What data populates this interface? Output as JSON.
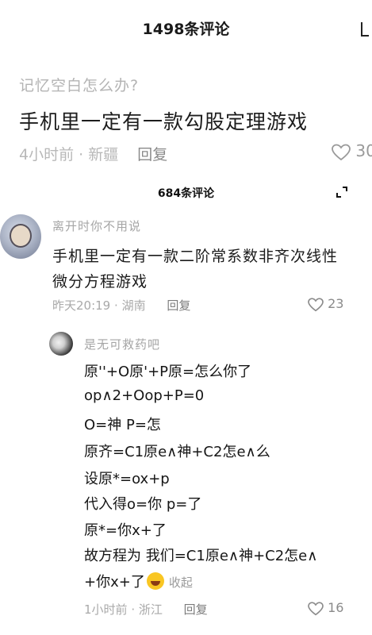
{
  "header": {
    "title": "1498条评论",
    "close_icon": "close-icon"
  },
  "top_comment": {
    "question": "记忆空白怎么办?",
    "text": "手机里一定有一款勾股定理游戏",
    "time": "4小时前",
    "location": "新疆",
    "reply_label": "回复",
    "likes": "30"
  },
  "embedded": {
    "title": "684条评论",
    "expand_icon": "expand-icon",
    "comment1": {
      "username": "离开时你不用说",
      "line1": "手机里一定有一款二阶常系数非齐次线性",
      "line2": "微分方程游戏",
      "time": "昨天20:19",
      "location": "湖南",
      "reply_label": "回复",
      "likes": "23"
    },
    "comment2": {
      "username": "是无可救药吧",
      "lines": [
        "原''+O原'+P原=怎么你了",
        "op∧2+Oop+P=0",
        "O=神 P=怎",
        "原齐=C1原e∧神+C2怎e∧么",
        "设原*=ox+p",
        "代入得o=你 p=了",
        "原*=你x+了",
        "故方程为 我们=C1原e∧神+C2怎e∧",
        "+你x+了"
      ],
      "emoji": "laughing-emoji",
      "collapse_label": "收起",
      "time": "1小时前",
      "location": "浙江",
      "reply_label": "回复",
      "likes": "16"
    }
  },
  "colors": {
    "text": "#161616",
    "muted": "#a9a9a9",
    "background": "#ffffff"
  }
}
